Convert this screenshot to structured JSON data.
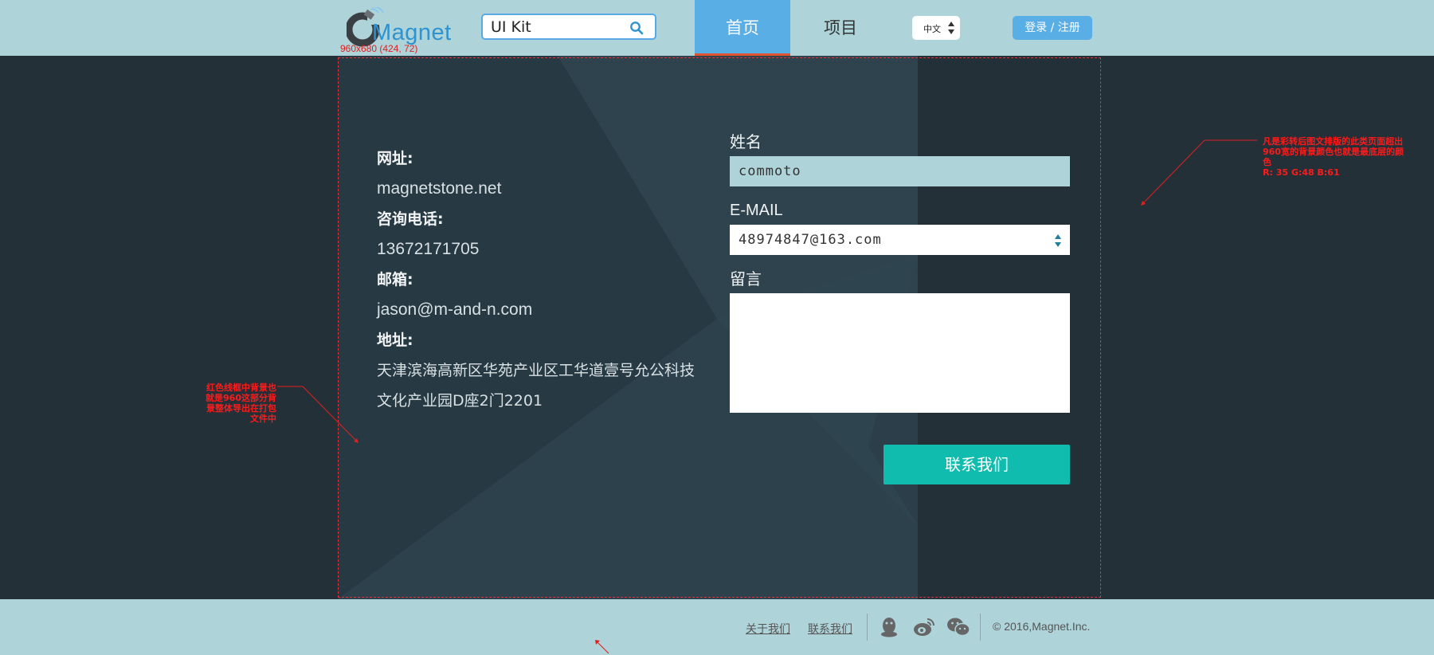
{
  "header": {
    "logo_text": "Magnet",
    "dimension_note": "960x680 (424, 72)",
    "search_value": "UI Kit",
    "nav": [
      {
        "label": "首页",
        "active": true
      },
      {
        "label": "项目",
        "active": false
      }
    ],
    "language": "中文",
    "login_label": "登录 / 注册"
  },
  "contact": {
    "website_label": "网址:",
    "website": "magnetstone.net",
    "phone_label": "咨询电话:",
    "phone": "13672171705",
    "email_label": "邮箱:",
    "email": "jason@m-and-n.com",
    "address_label": "地址:",
    "address": "天津滨海高新区华苑产业区工华道壹号允公科技文化产业园D座2门2201"
  },
  "form": {
    "name_label": "姓名",
    "name_value": "commoto",
    "email_label": "E-MAIL",
    "email_value": "48974847@163.com",
    "message_label": "留言",
    "message_value": "",
    "submit_label": "联系我们"
  },
  "annotations": {
    "right": "凡是彩转后图文排版的此类页面超出960宽的背景颜色也就是最底层的颜色\nR: 35 G:48 B:61",
    "left": "红色线框中背景也就是960这部分背景整体导出在打包文件中"
  },
  "footer": {
    "links": [
      "关于我们",
      "联系我们"
    ],
    "copyright": "© 2016,Magnet.Inc."
  },
  "colors": {
    "header_bg": "#aed4da",
    "body_bg": "#233038",
    "accent_blue": "#5aaee6",
    "accent_teal": "#0fbcae",
    "nav_underline": "#e2542f",
    "note_red": "#e02020"
  }
}
